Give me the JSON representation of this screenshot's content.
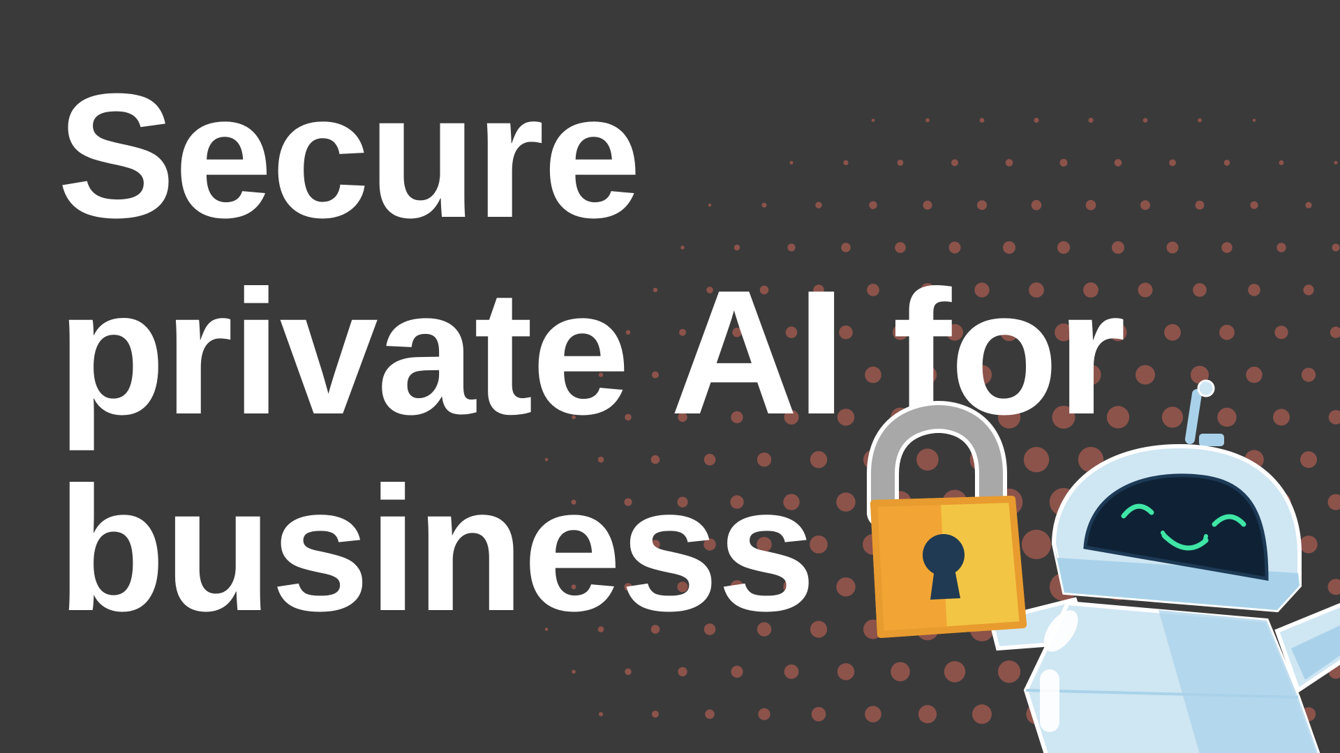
{
  "headline": {
    "line1": "Secure",
    "line2": "private AI for",
    "line3": "business"
  },
  "colors": {
    "background": "#3a3a3a",
    "dots": "#8c534b",
    "text": "#ffffff",
    "lock_body_left": "#f2a534",
    "lock_body_right": "#f3c545",
    "lock_shackle": "#a8a8a8",
    "keyhole": "#1f3a52",
    "robot_body": "#cfe6f3",
    "robot_shadow": "#a9d2ea",
    "robot_visor": "#0f2235",
    "robot_face": "#3fe6a6"
  },
  "icons": {
    "lock": "padlock-icon",
    "robot": "robot-mascot"
  }
}
